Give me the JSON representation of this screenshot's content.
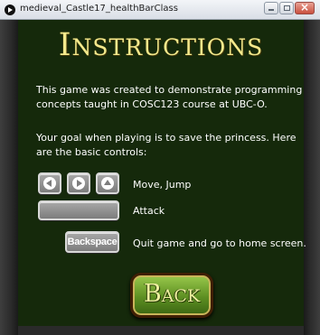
{
  "window": {
    "title": "medieval_Castle17_healthBarClass",
    "controls": [
      "minimize",
      "maximize",
      "close"
    ]
  },
  "screen": {
    "heading": "Instructions",
    "intro": "This game was created to demonstrate programming concepts taught in COSC123 course at UBC-O.",
    "goal": "Your goal when playing is to save the princess. Here are the basic controls:",
    "controls": [
      {
        "keys": [
          "left-arrow-key-icon",
          "right-arrow-key-icon",
          "up-arrow-key-icon"
        ],
        "label": "Move, Jump"
      },
      {
        "keys": [
          "spacebar-key-icon"
        ],
        "label": "Attack"
      },
      {
        "key_text": "Backspace",
        "label": "Quit game and go to home screen."
      }
    ],
    "back_label": "Back"
  },
  "colors": {
    "background": "#15290b",
    "heading": "#f3e98c",
    "text": "#ffffff",
    "button_green": "#5d8f22"
  }
}
